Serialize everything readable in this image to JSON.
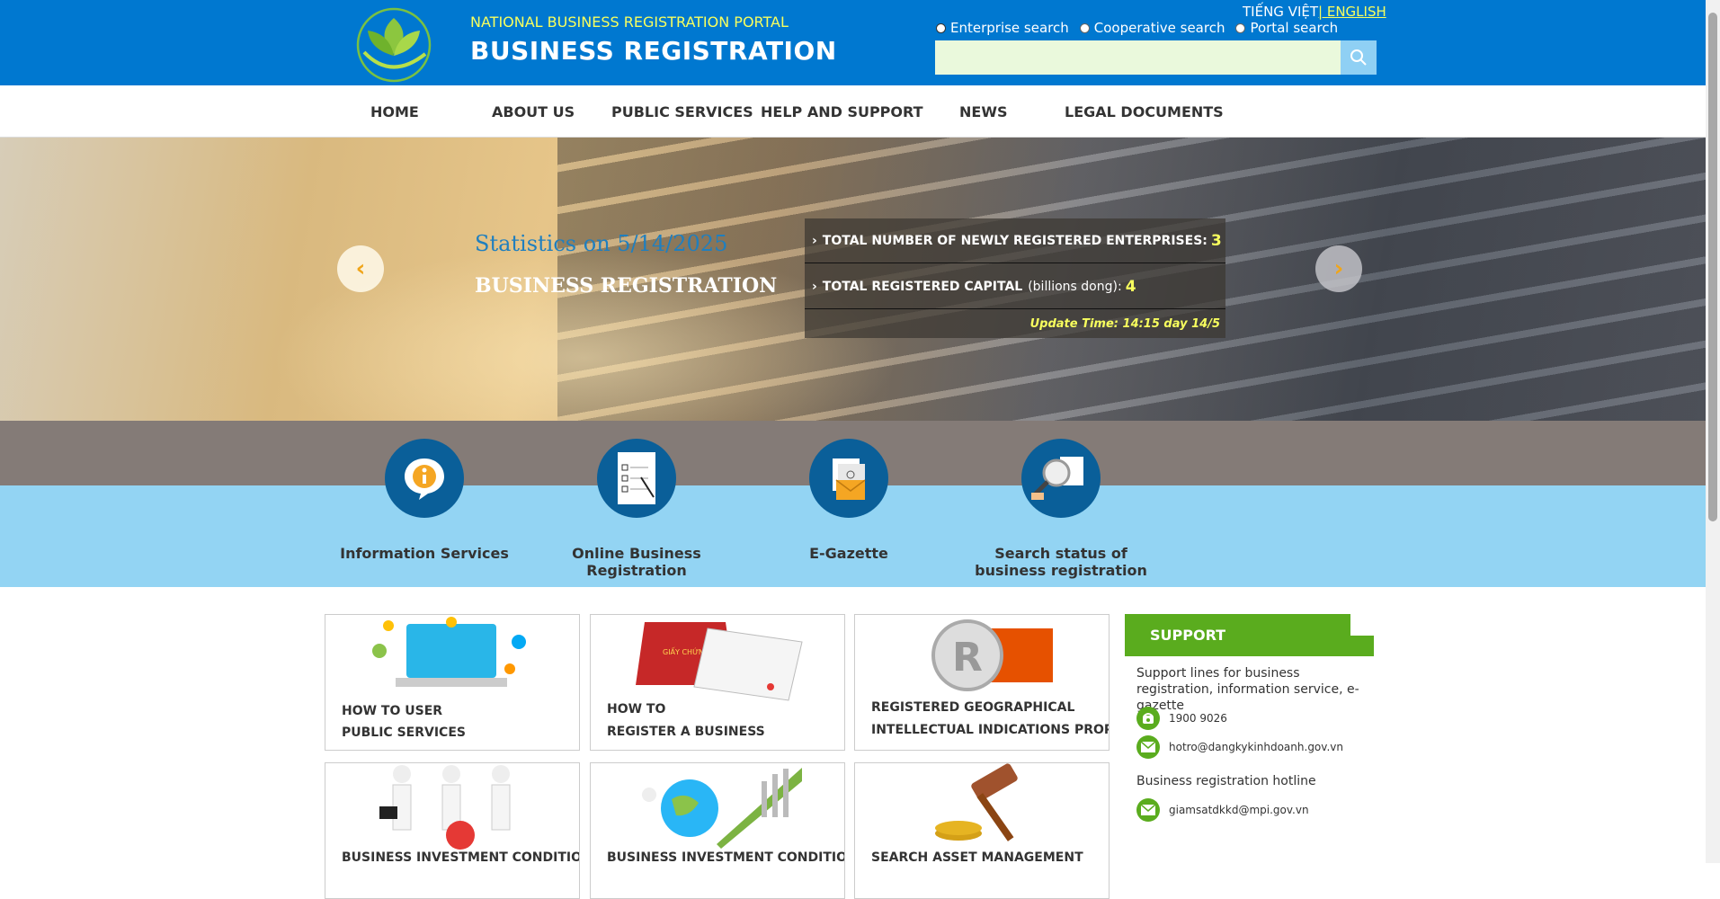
{
  "header": {
    "portal_subtitle": "NATIONAL BUSINESS REGISTRATION PORTAL",
    "portal_title": "BUSINESS REGISTRATION",
    "lang_vi": "TIẾNG VIỆT",
    "lang_en": "| ENGLISH",
    "search_options": [
      "Enterprise search",
      "Cooperative search",
      "Portal search"
    ],
    "search_selected": "Enterprise search",
    "search_value": "",
    "search_placeholder": ""
  },
  "nav": [
    "HOME",
    "ABOUT US",
    "PUBLIC SERVICES",
    "HELP AND SUPPORT",
    "NEWS",
    "LEGAL DOCUMENTS"
  ],
  "stats": {
    "date_label": "Statistics on 5/14/2025",
    "title": "BUSINESS REGISTRATION",
    "rows": [
      {
        "label": "TOTAL NUMBER OF NEWLY REGISTERED ENTERPRISES:",
        "unit": "",
        "value": "3"
      },
      {
        "label": "TOTAL REGISTERED CAPITAL",
        "unit": "(billions dong):",
        "value": "4"
      }
    ],
    "update_time": "Update Time: 14:15 day 14/5"
  },
  "services": [
    "Information Services",
    "Online Business Registration",
    "E-Gazette",
    "Search status of business registration"
  ],
  "cards": [
    {
      "line1": "HOW TO USER",
      "line2": "PUBLIC SERVICES"
    },
    {
      "line1": "HOW TO",
      "line2": "REGISTER A BUSINESS"
    },
    {
      "line1": "REGISTERED GEOGRAPHICAL",
      "line2": "INTELLECTUAL INDICATIONS PROPERTY"
    },
    {
      "line1": "BUSINESS INVESTMENT CONDITIONS",
      "line2": ""
    },
    {
      "line1": "BUSINESS INVESTMENT CONDITIONS",
      "line2": ""
    },
    {
      "line1": "SEARCH ASSET MANAGEMENT",
      "line2": ""
    }
  ],
  "support": {
    "title": "SUPPORT",
    "desc": "Support lines for business registration, information service, e-gazette",
    "phone": "1900 9026",
    "email1": "hotro@dangkykinhdoanh.gov.vn",
    "hotline_label": "Business registration hotline",
    "email2": "giamsatdkkd@mpi.gov.vn"
  },
  "colors": {
    "header_blue": "#0078d0",
    "accent_yellow": "#f8ff5e",
    "service_blue": "#93d4f3",
    "support_green": "#5aac1e"
  }
}
